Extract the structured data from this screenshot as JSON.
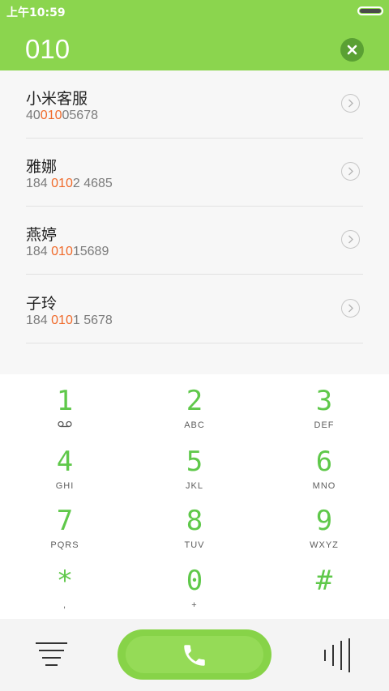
{
  "status": {
    "time": "上午10:59"
  },
  "dialer": {
    "number": "010"
  },
  "contacts": [
    {
      "name": "小米客服",
      "pre": "40",
      "match": "010",
      "post": "05678"
    },
    {
      "name": "雅娜",
      "pre": "184 ",
      "match": "010",
      "post": "2 4685"
    },
    {
      "name": "燕婷",
      "pre": "184 ",
      "match": "010",
      "post": "15689"
    },
    {
      "name": "子玲",
      "pre": "184 ",
      "match": "010",
      "post": "1 5678"
    }
  ],
  "keys": [
    {
      "digit": "1",
      "letters": ""
    },
    {
      "digit": "2",
      "letters": "ABC"
    },
    {
      "digit": "3",
      "letters": "DEF"
    },
    {
      "digit": "4",
      "letters": "GHI"
    },
    {
      "digit": "5",
      "letters": "JKL"
    },
    {
      "digit": "6",
      "letters": "MNO"
    },
    {
      "digit": "7",
      "letters": "PQRS"
    },
    {
      "digit": "8",
      "letters": "TUV"
    },
    {
      "digit": "9",
      "letters": "WXYZ"
    },
    {
      "digit": "*",
      "letters": ","
    },
    {
      "digit": "0",
      "letters": "+"
    },
    {
      "digit": "#",
      "letters": ""
    }
  ],
  "colors": {
    "accent": "#8bd54e",
    "highlight": "#f06a2a",
    "key_digit": "#5fc84a"
  },
  "icons": {
    "clear": "clear-icon",
    "arrow": "chevron-right-icon",
    "voicemail": "voicemail-icon",
    "menu": "menu-icon",
    "call": "phone-icon",
    "keypad_toggle": "keypad-toggle-icon"
  }
}
